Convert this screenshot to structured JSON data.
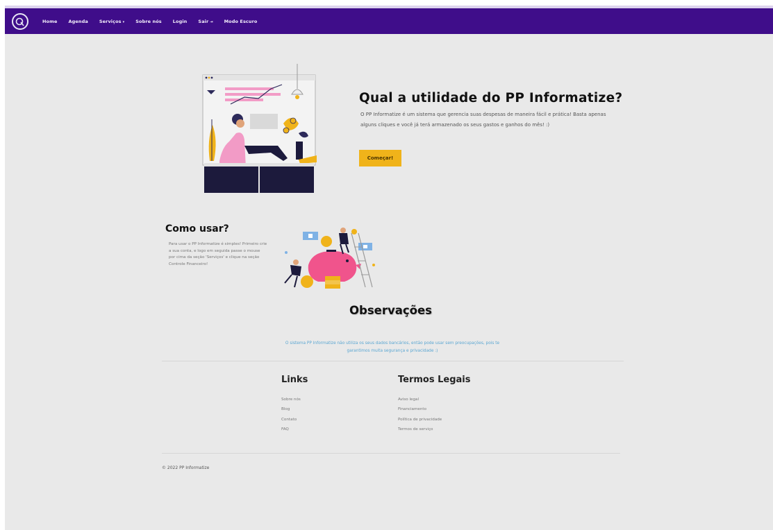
{
  "nav": {
    "items": [
      {
        "label": "Home",
        "caret": false
      },
      {
        "label": "Agenda",
        "caret": false
      },
      {
        "label": "Serviços",
        "caret": true
      },
      {
        "label": "Sobre nós",
        "caret": false
      },
      {
        "label": "Login",
        "caret": false
      },
      {
        "label": "Sair",
        "caret": false,
        "icon": true
      },
      {
        "label": "Modo Escuro",
        "caret": false
      }
    ]
  },
  "hero": {
    "title": "Qual a utilidade do PP Informatize?",
    "text": "O PP Informatize é um sistema que gerencia suas despesas de maneira fácil e prática! Basta apenas alguns cliques e você já terá armazenado os seus gastos e ganhos do mês! :)",
    "button_label": "Começar!"
  },
  "how": {
    "title": "Como usar?",
    "text": "Para usar o PP Informatize é simples! Primeiro crie a sua conta, e logo em seguida passe o mouse por cima da seção 'Serviços' e clique na seção Controle Financeiro!"
  },
  "obs": {
    "title": "Observações",
    "text": "O sistema PP Informatize não utiliza os seus dados bancários, então pode usar sem preocupações, pois te garantimos muita segurança e privacidade :)"
  },
  "footer": {
    "links_title": "Links",
    "links": [
      "Sobre nós",
      "Blog",
      "Contato",
      "FAQ"
    ],
    "legal_title": "Termos Legais",
    "legal": [
      "Aviso legal",
      "Financiamento",
      "Política de privacidade",
      "Termos de serviço"
    ],
    "copyright": "© 2022 PP Informatize"
  },
  "colors": {
    "navbar": "#3f0d8a",
    "accent": "#f0b31a",
    "info_text": "#5aa6d2",
    "background": "#e9e9e9"
  }
}
